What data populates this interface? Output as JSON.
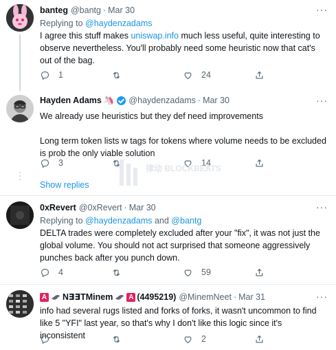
{
  "tweets": [
    {
      "name": "banteg",
      "handle": "@bantg",
      "time": "Mar 30",
      "reply_prefix": "Replying to ",
      "reply_to": "@haydenzadams",
      "text_a": "I agree this stuff makes ",
      "text_link": "uniswap.info",
      "text_b": " much less useful, quite interesting to observe nevertheless. You'll probably need some heuristic now that cat's out of the bag.",
      "replies": "1",
      "retweets": "",
      "likes": "24"
    },
    {
      "name": "Hayden Adams",
      "name_emoji": "🦄",
      "handle": "@haydenzadams",
      "time": "Mar 30",
      "text_1": "We already use heuristics but they def need improvements",
      "text_2": "Long term token lists w tags for tokens where volume needs to be excluded is prob the only viable solution",
      "replies": "3",
      "retweets": "",
      "likes": "14"
    },
    {
      "name": "0xRevert",
      "handle": "@0xRevert",
      "time": "Mar 30",
      "reply_prefix": "Replying to ",
      "reply_to": "@haydenzadams",
      "reply_and": " and ",
      "reply_to_2": "@bantg",
      "text": "DELTA trades were completely excluded after your \"fix\", it was not just the global volume. You should not act surprised that someone aggressively punches back after you punch down.",
      "replies": "4",
      "retweets": "",
      "likes": "59"
    },
    {
      "name_prefix": "A",
      "name": "N∃∃TMinem",
      "name_suffix": "A",
      "name_id": "(4495219)",
      "handle": "@MinemNeet",
      "time": "Mar 31",
      "text": "info had several rugs listed and forks of forks, it wasn't uncommon to find like 5 \"YFI\" last year, so that's why I don't like this logic since it's inconsistent",
      "replies": "",
      "retweets": "",
      "likes": "2"
    }
  ],
  "show_replies": "Show replies",
  "more": "···",
  "sep": "·",
  "watermark": "律动 BLOCKBEATS"
}
